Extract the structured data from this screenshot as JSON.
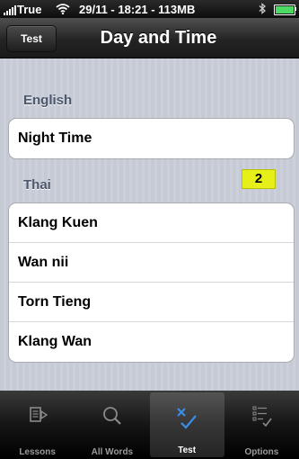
{
  "status_bar": {
    "carrier": "True",
    "center_text": "29/11 - 18:21 - 113MB",
    "wifi_icon": "wifi-icon",
    "bluetooth_icon": "bluetooth-icon",
    "battery_icon": "battery-icon"
  },
  "nav": {
    "back_label": "Test",
    "title": "Day and Time"
  },
  "sections": {
    "english": {
      "header": "English",
      "rows": [
        "Night Time"
      ]
    },
    "thai": {
      "header": "Thai",
      "badge": "2",
      "rows": [
        "Klang Kuen",
        "Wan nii",
        "Torn Tieng",
        "Klang Wan"
      ]
    }
  },
  "tabs": [
    {
      "label": "Lessons",
      "icon": "lessons-icon",
      "selected": false
    },
    {
      "label": "All Words",
      "icon": "search-icon",
      "selected": false
    },
    {
      "label": "Test",
      "icon": "checkmark-icon",
      "selected": true
    },
    {
      "label": "Options",
      "icon": "options-list-icon",
      "selected": false
    }
  ],
  "colors": {
    "badge": "#e6f018",
    "section_header": "#4c566c",
    "selected_tab_icon": "#3a8ee6"
  }
}
